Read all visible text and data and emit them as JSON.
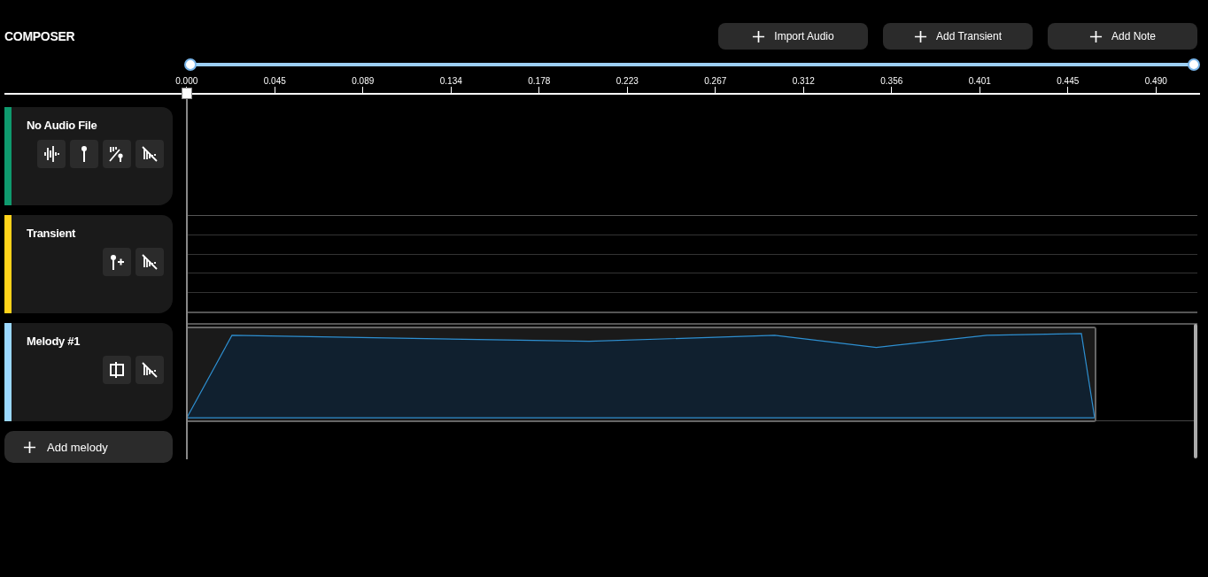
{
  "title": "COMPOSER",
  "toolbar": [
    {
      "label": "Import Audio"
    },
    {
      "label": "Add Transient"
    },
    {
      "label": "Add Note"
    }
  ],
  "zoom_range": [
    {
      "level": 0
    },
    {
      "level": 1
    }
  ],
  "ruler": {
    "ticks": [
      "0.000",
      "0.045",
      "0.089",
      "0.134",
      "0.178",
      "0.223",
      "0.267",
      "0.312",
      "0.356",
      "0.401",
      "0.445",
      "0.490"
    ]
  },
  "tracks": [
    {
      "name": "No Audio File",
      "color": "#0f9a6e",
      "kind": "audio",
      "actions": [
        {
          "kind": "waveform"
        },
        {
          "kind": "pin"
        },
        {
          "kind": "pin-slash"
        },
        {
          "kind": "mute"
        }
      ]
    },
    {
      "name": "Transient",
      "color": "#ffd21a",
      "kind": "transient",
      "actions": [
        {
          "kind": "pin-plus"
        },
        {
          "kind": "mute"
        }
      ]
    },
    {
      "name": "Melody #1",
      "color": "#9ad8ff",
      "kind": "melody",
      "actions": [
        {
          "kind": "split"
        },
        {
          "kind": "mute"
        }
      ]
    }
  ],
  "add_melody": {
    "label": "Add melody"
  }
}
